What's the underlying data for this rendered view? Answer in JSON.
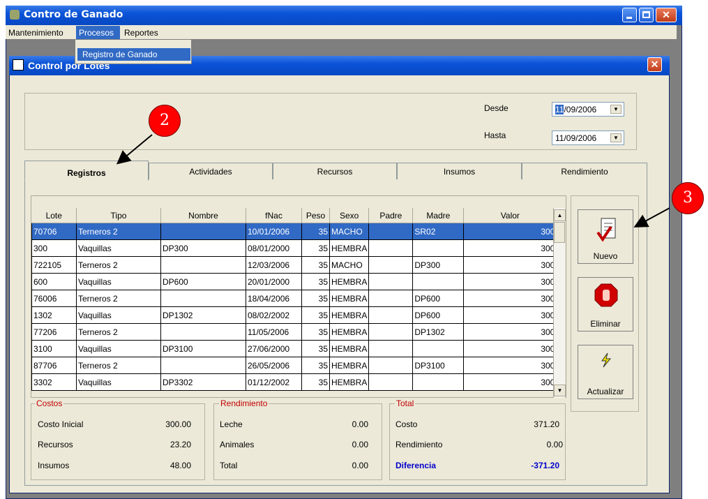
{
  "app": {
    "title": "Contro de Ganado"
  },
  "menu": {
    "items": [
      "Mantenimiento",
      "Procesos",
      "Reportes"
    ],
    "dropdown_item": "Registro de Ganado"
  },
  "form": {
    "title": "Control por Lotes"
  },
  "dates": {
    "desde_label": "Desde",
    "desde_day": "11",
    "desde_rest": "/09/2006",
    "hasta_label": "Hasta",
    "hasta_value": "11/09/2006"
  },
  "tabs": [
    "Registros",
    "Actividades",
    "Recursos",
    "Insumos",
    "Rendimiento"
  ],
  "grid": {
    "columns": [
      "Lote",
      "Tipo",
      "Nombre",
      "fNac",
      "Peso",
      "Sexo",
      "Padre",
      "Madre",
      "Valor"
    ],
    "rows": [
      [
        "70706",
        "Terneros 2",
        "",
        "10/01/2006",
        "35",
        "MACHO",
        "",
        "SR02",
        "300"
      ],
      [
        "300",
        "Vaquillas",
        "DP300",
        "08/01/2000",
        "35",
        "HEMBRA",
        "",
        "",
        "300"
      ],
      [
        "722105",
        "Terneros 2",
        "",
        "12/03/2006",
        "35",
        "MACHO",
        "",
        "DP300",
        "300"
      ],
      [
        "600",
        "Vaquillas",
        "DP600",
        "20/01/2000",
        "35",
        "HEMBRA",
        "",
        "",
        "300"
      ],
      [
        "76006",
        "Terneros 2",
        "",
        "18/04/2006",
        "35",
        "HEMBRA",
        "",
        "DP600",
        "300"
      ],
      [
        "1302",
        "Vaquillas",
        "DP1302",
        "08/02/2002",
        "35",
        "HEMBRA",
        "",
        "DP600",
        "300"
      ],
      [
        "77206",
        "Terneros 2",
        "",
        "11/05/2006",
        "35",
        "HEMBRA",
        "",
        "DP1302",
        "300"
      ],
      [
        "3100",
        "Vaquillas",
        "DP3100",
        "27/06/2000",
        "35",
        "HEMBRA",
        "",
        "",
        "300"
      ],
      [
        "87706",
        "Terneros 2",
        "",
        "26/05/2006",
        "35",
        "HEMBRA",
        "",
        "DP3100",
        "300"
      ],
      [
        "3302",
        "Vaquillas",
        "DP3302",
        "01/12/2002",
        "35",
        "HEMBRA",
        "",
        "",
        "300"
      ]
    ]
  },
  "buttons": {
    "nuevo": "Nuevo",
    "eliminar": "Eliminar",
    "actualizar": "Actualizar"
  },
  "costos": {
    "title": "Costos",
    "rows": [
      [
        "Costo Inicial",
        "300.00"
      ],
      [
        "Recursos",
        "23.20"
      ],
      [
        "Insumos",
        "48.00"
      ]
    ]
  },
  "rendimiento": {
    "title": "Rendimiento",
    "rows": [
      [
        "Leche",
        "0.00"
      ],
      [
        "Animales",
        "0.00"
      ],
      [
        "Total",
        "0.00"
      ]
    ]
  },
  "total": {
    "title": "Total",
    "rows": [
      [
        "Costo",
        "371.20"
      ],
      [
        "Rendimiento",
        "0.00"
      ]
    ],
    "diferencia_label": "Diferencia",
    "diferencia_value": "-371.20"
  },
  "callouts": {
    "two": "2",
    "three": "3"
  },
  "colors": {
    "titlebar": "#0a53d8",
    "selection": "#316ac5",
    "callout": "#ff0000",
    "group_title": "#c00000",
    "diferencia": "#0000cc"
  }
}
